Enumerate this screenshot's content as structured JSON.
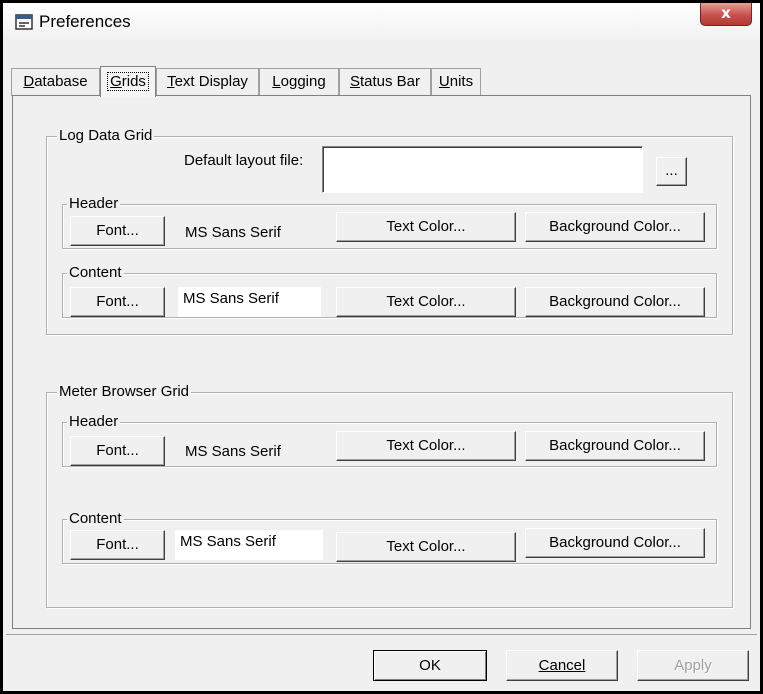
{
  "window": {
    "title": "Preferences",
    "close_label": "x",
    "icon": "preferences-window-icon"
  },
  "tabs": [
    {
      "label": "Database",
      "mnemonic_index": 0,
      "active": false
    },
    {
      "label": "Grids",
      "mnemonic_index": 0,
      "active": true
    },
    {
      "label": "Text Display",
      "mnemonic_index": 0,
      "active": false
    },
    {
      "label": "Logging",
      "mnemonic_index": 0,
      "active": false
    },
    {
      "label": "Status Bar",
      "mnemonic_index": 0,
      "active": false
    },
    {
      "label": "Units",
      "mnemonic_index": 0,
      "active": false
    }
  ],
  "log_data_grid": {
    "title": "Log Data Grid",
    "default_layout_label": "Default layout file:",
    "default_layout_value": "",
    "browse_label": "...",
    "header": {
      "title": "Header",
      "font_button": "Font...",
      "font_name": "MS Sans Serif",
      "text_color_button": "Text Color...",
      "bg_color_button": "Background Color..."
    },
    "content": {
      "title": "Content",
      "font_button": "Font...",
      "font_name": "MS Sans Serif",
      "text_color_button": "Text Color...",
      "bg_color_button": "Background Color..."
    }
  },
  "meter_browser_grid": {
    "title": "Meter Browser Grid",
    "header": {
      "title": "Header",
      "font_button": "Font...",
      "font_name": "MS Sans Serif",
      "text_color_button": "Text Color...",
      "bg_color_button": "Background Color..."
    },
    "content": {
      "title": "Content",
      "font_button": "Font...",
      "font_name": "MS Sans Serif",
      "text_color_button": "Text Color...",
      "bg_color_button": "Background Color..."
    }
  },
  "footer": {
    "ok": "OK",
    "cancel": "Cancel",
    "apply": "Apply"
  },
  "colors": {
    "close_button": "#c75050",
    "dialog_bg": "#f0f0f0"
  }
}
